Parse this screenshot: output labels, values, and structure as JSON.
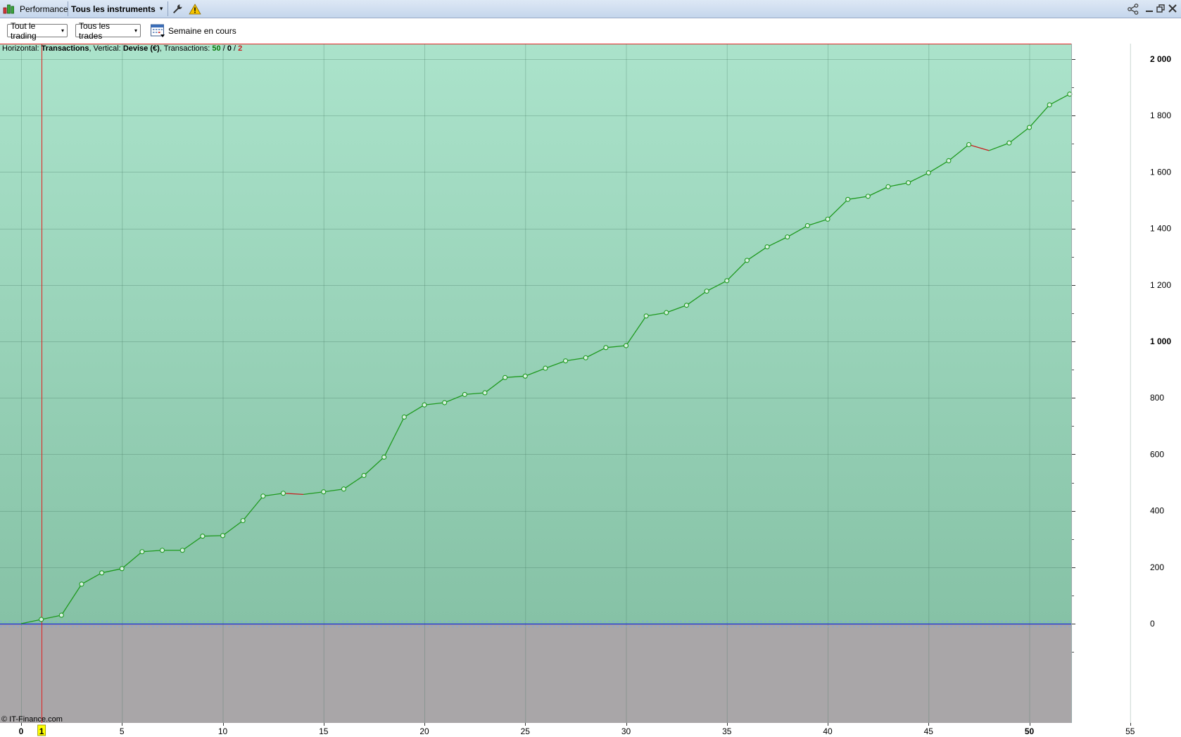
{
  "titlebar": {
    "title": "Performance",
    "instrument": "Tous les instruments",
    "caret": "▾"
  },
  "toolbar": {
    "filter_trading": "Tout le trading",
    "filter_trades": "Tous les trades",
    "period": "Semaine en cours",
    "caret": "▾"
  },
  "info": {
    "horizontal_label": "Horizontal:",
    "horizontal_value": "Transactions",
    "vertical_label": ", Vertical:",
    "vertical_value": "Devise (€)",
    "transactions_label": ", Transactions:",
    "winning": "50",
    "sep1": " / ",
    "neutral": "0",
    "sep2": " / ",
    "losing": "2"
  },
  "copyright": "© IT-Finance.com",
  "colors": {
    "profit_zone_top": "#abe3cb",
    "profit_zone_bottom": "#86c2a6",
    "loss_zone": "#a9a6a8",
    "line_up": "#1f9a1f",
    "line_down": "#c81e1e",
    "zero_line": "#2a3bd0",
    "cursor_line": "#e02020",
    "cursor_badge": "#ffff00"
  },
  "chart_data": {
    "type": "line",
    "xlim": [
      0,
      56
    ],
    "ylim": [
      -190,
      2060
    ],
    "x_ticks": [
      0,
      5,
      10,
      15,
      20,
      25,
      30,
      35,
      40,
      45,
      50,
      55
    ],
    "x_bold_ticks": [
      0,
      50
    ],
    "cursor_x": 1,
    "cursor_label": "1",
    "y_ticks": [
      0,
      200,
      400,
      600,
      800,
      1000,
      1200,
      1400,
      1600,
      1800,
      2000
    ],
    "y_tick_labels": [
      "0",
      "200",
      "400",
      "600",
      "800",
      "1 000",
      "1 200",
      "1 400",
      "1 600",
      "1 800",
      "2 000"
    ],
    "y_bold_ticks": [
      1000,
      2000
    ],
    "grid": true,
    "x": [
      0,
      1,
      2,
      3,
      4,
      5,
      6,
      7,
      8,
      9,
      10,
      11,
      12,
      13,
      14,
      15,
      16,
      17,
      18,
      19,
      20,
      21,
      22,
      23,
      24,
      25,
      26,
      27,
      28,
      29,
      30,
      31,
      32,
      33,
      34,
      35,
      36,
      37,
      38,
      39,
      40,
      41,
      42,
      43,
      44,
      45,
      46,
      47,
      48,
      49,
      50,
      51,
      52
    ],
    "values": [
      0,
      15,
      30,
      140,
      180,
      195,
      255,
      260,
      260,
      310,
      312,
      365,
      452,
      462,
      458,
      467,
      477,
      525,
      590,
      732,
      775,
      783,
      812,
      818,
      872,
      877,
      905,
      931,
      942,
      978,
      985,
      1090,
      1102,
      1128,
      1178,
      1215,
      1287,
      1335,
      1370,
      1410,
      1433,
      1503,
      1514,
      1548,
      1562,
      1597,
      1640,
      1697,
      1676,
      1703,
      1758,
      1838,
      1876
    ],
    "markers_omitted_at": [
      0,
      14,
      48
    ]
  }
}
